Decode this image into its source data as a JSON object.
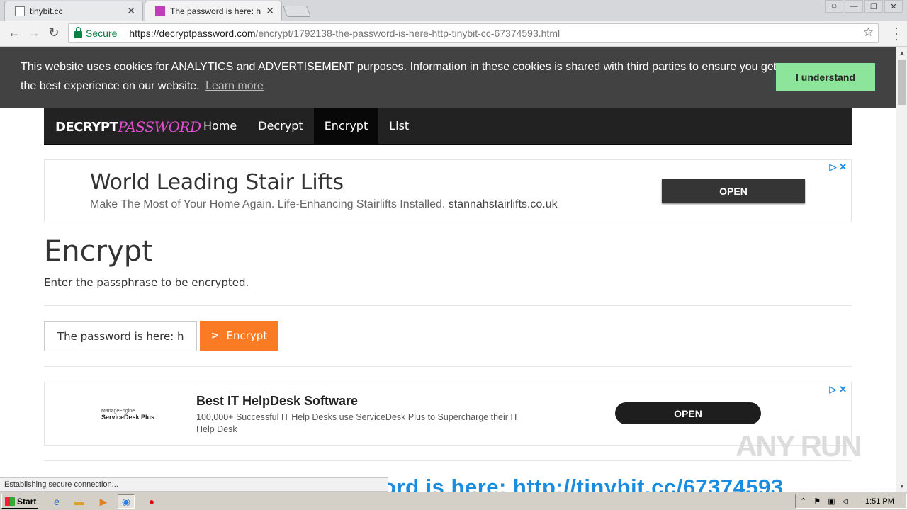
{
  "browser": {
    "tabs": [
      {
        "label": "tinybit.cc",
        "active": false
      },
      {
        "label": "The password is here: http:",
        "active": true
      }
    ],
    "secure_label": "Secure",
    "url_host": "https://decryptpassword.com",
    "url_path": "/encrypt/1792138-the-password-is-here-http-tinybit-cc-67374593.html",
    "status_text": "Establishing secure connection..."
  },
  "cookie_banner": {
    "text": "This website uses cookies for ANALYTICS and ADVERTISEMENT purposes. Information in these cookies is shared with third parties to ensure you get the best experience on our website.",
    "link": "Learn more",
    "button": "I understand"
  },
  "site_nav": {
    "brand_part1": "DECRYPT",
    "brand_part2": "PASSWORD",
    "links": [
      {
        "label": "Home",
        "active": false
      },
      {
        "label": "Decrypt",
        "active": false
      },
      {
        "label": "Encrypt",
        "active": true
      },
      {
        "label": "List",
        "active": false
      }
    ]
  },
  "ad1": {
    "title": "World Leading Stair Lifts",
    "description": "Make The Most of Your Home Again. Life-Enhancing Stairlifts Installed.",
    "domain": "stannahstairlifts.co.uk",
    "button": "OPEN"
  },
  "main": {
    "heading": "Encrypt",
    "lead": "Enter the passphrase to be encrypted.",
    "input_value": "The password is here: http",
    "button": "Encrypt"
  },
  "ad2": {
    "logo_line1": "ManageEngine",
    "logo_line2": "ServiceDesk Plus",
    "title": "Best IT HelpDesk Software",
    "description": "100,000+ Successful IT Help Desks use ServiceDesk Plus to Supercharge their IT Help Desk",
    "button": "OPEN"
  },
  "bottom_link": "ord is here: http://tinybit.cc/67374593",
  "watermark": "ANY RUN",
  "taskbar": {
    "start": "Start",
    "clock": "1:51 PM"
  },
  "colors": {
    "accent_orange": "#fb7a24",
    "cookie_button": "#8ce59a",
    "link_blue": "#1a8ce0",
    "nav_dark": "#222222"
  }
}
